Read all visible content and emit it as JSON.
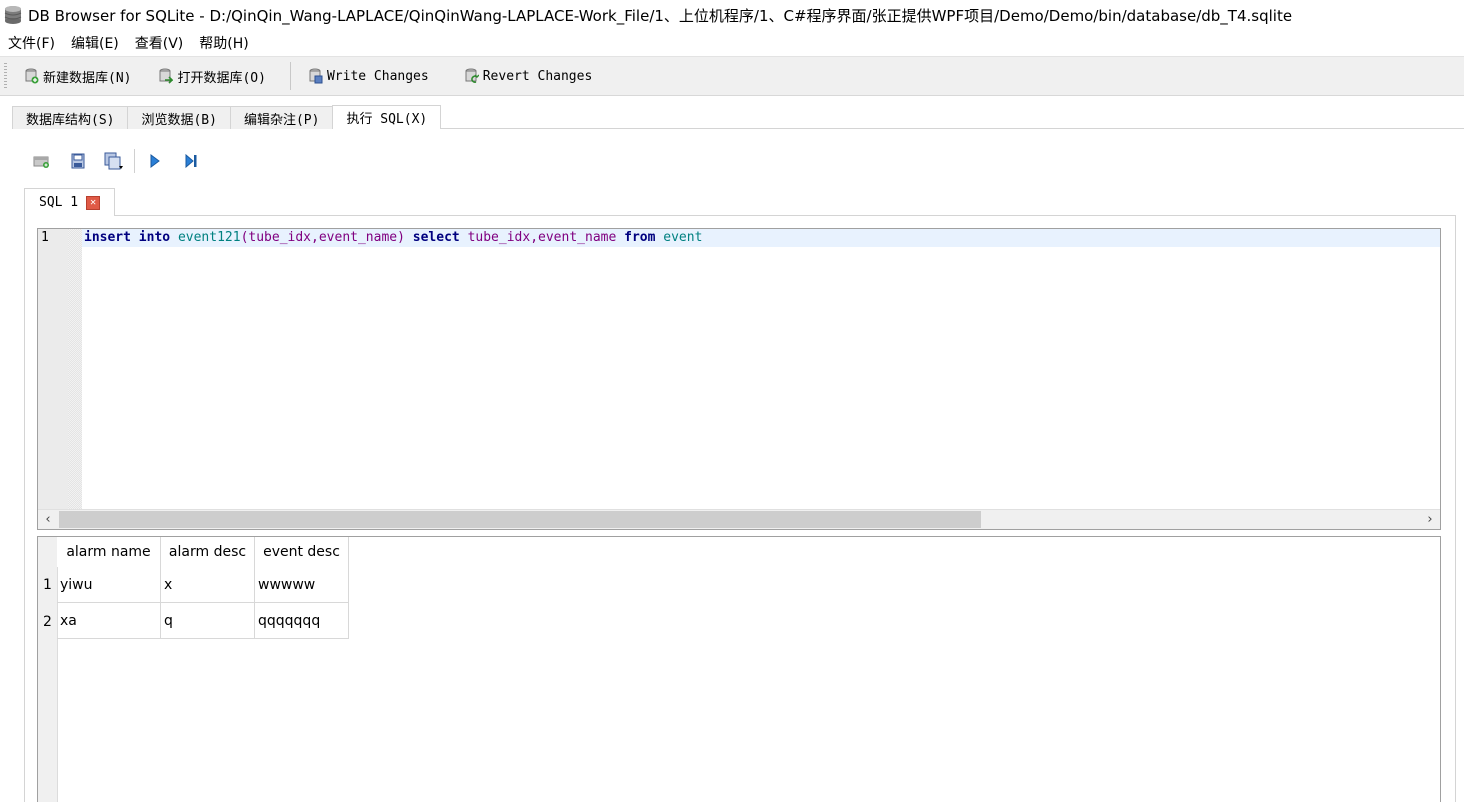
{
  "window": {
    "title": "DB Browser for SQLite - D:/QinQin_Wang-LAPLACE/QinQinWang-LAPLACE-Work_File/1、上位机程序/1、C#程序界面/张正提供WPF项目/Demo/Demo/bin/database/db_T4.sqlite"
  },
  "menu": {
    "file": "文件(F)",
    "edit": "编辑(E)",
    "view": "查看(V)",
    "help": "帮助(H)"
  },
  "toolbar": {
    "new_db": "新建数据库(N)",
    "open_db": "打开数据库(O)",
    "write_changes": "Write Changes",
    "revert_changes": "Revert Changes"
  },
  "tabs": {
    "structure": "数据库结构(S)",
    "browse": "浏览数据(B)",
    "pragmas": "编辑杂注(P)",
    "execute": "执行 SQL(X)"
  },
  "editor": {
    "tab_label": "SQL 1",
    "line_number": "1",
    "tokens": {
      "t1": "insert",
      "t2": " ",
      "t3": "into",
      "t4": " ",
      "t5": "event121",
      "t6": "(",
      "t7": "tube_idx",
      "t8": ",",
      "t9": "event_name",
      "t10": ")",
      "t11": " ",
      "t12": "select",
      "t13": " ",
      "t14": "tube_idx",
      "t15": ",",
      "t16": "event_name",
      "t17": " ",
      "t18": "from",
      "t19": " ",
      "t20": "event"
    }
  },
  "results": {
    "columns": [
      "alarm name",
      "alarm desc",
      "event desc"
    ],
    "row_numbers": [
      "1",
      "2"
    ],
    "rows": [
      [
        "yiwu",
        "x",
        "wwwww"
      ],
      [
        "xa",
        "q",
        "qqqqqqq"
      ]
    ]
  },
  "colors": {
    "keyword": "#00007f",
    "identifier": "#008080",
    "punctuation": "#800080",
    "caret_line": "#e8f2fe"
  }
}
